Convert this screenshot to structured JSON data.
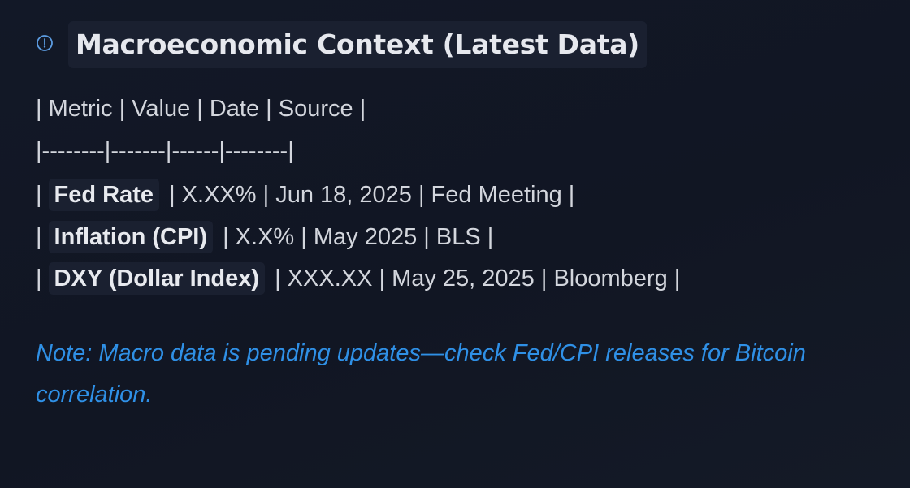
{
  "section": {
    "icon": "info-circle-icon",
    "title": "Macroeconomic Context (Latest Data)"
  },
  "table_text": {
    "header_line": "| Metric | Value | Date | Source |",
    "separator_line": "|--------|-------|------|--------|",
    "rows": [
      {
        "prefix": "|",
        "metric": "Fed Rate",
        "rest": "| X.XX% | Jun 18, 2025 | Fed Meeting |"
      },
      {
        "prefix": "|",
        "metric": "Inflation (CPI)",
        "rest": "| X.X% | May 2025 | BLS |"
      },
      {
        "prefix": "|",
        "metric": "DXY (Dollar Index)",
        "rest": "| XXX.XX | May 25, 2025 | Bloomberg |"
      }
    ]
  },
  "note": "Note: Macro data is pending updates—check Fed/CPI releases for Bitcoin correlation.",
  "colors": {
    "background": "#121827",
    "chip_background": "#1a2030",
    "note_text": "#2f90e6",
    "icon_stroke": "#5b9be0"
  }
}
